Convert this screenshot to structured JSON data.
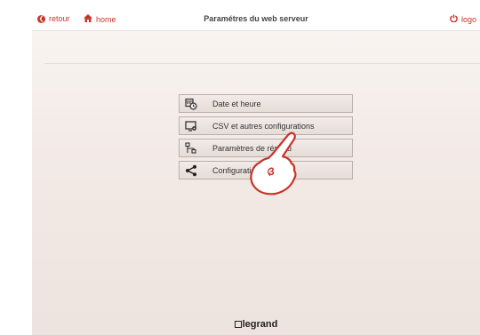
{
  "topbar": {
    "retour_label": "retour",
    "home_label": "home",
    "title": "Paramétres du web serveur",
    "logout_label": "logo"
  },
  "menu": {
    "items": [
      {
        "label": "Date et heure",
        "icon": "calendar-clock-icon"
      },
      {
        "label": "CSV et autres configurations",
        "icon": "monitor-gear-icon"
      },
      {
        "label": "Paramètres de réseau",
        "icon": "network-icon"
      },
      {
        "label": "Configuration Modbus",
        "icon": "share-icon"
      }
    ]
  },
  "overlay": {
    "step_number": "3"
  },
  "footer": {
    "brand": "legrand"
  },
  "colors": {
    "accent": "#c8332a",
    "background": "#f3ebe7",
    "button": "#e6dcd8"
  }
}
